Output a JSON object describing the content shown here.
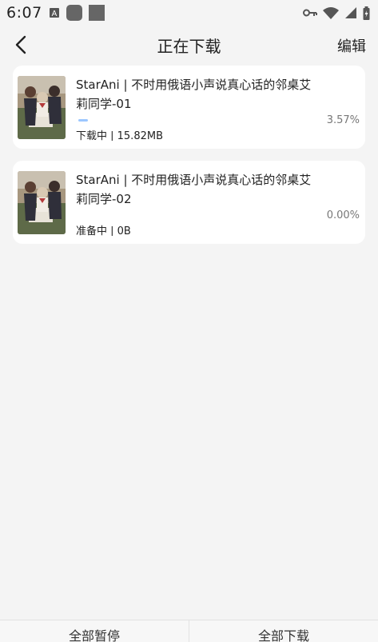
{
  "status_bar": {
    "time": "6:07"
  },
  "header": {
    "title": "正在下载",
    "edit_label": "编辑"
  },
  "downloads": [
    {
      "title": "StarAni | 不时用俄语小声说真心话的邻桌艾莉同学-01",
      "percent": "3.57%",
      "progress": 0.0357,
      "status": "下载中 | 15.82MB"
    },
    {
      "title": "StarAni | 不时用俄语小声说真心话的邻桌艾莉同学-02",
      "percent": "0.00%",
      "progress": 0.0,
      "status": "准备中 | 0B"
    }
  ],
  "bottom": {
    "pause_all": "全部暂停",
    "download_all": "全部下载"
  },
  "colors": {
    "background": "#f4f4f4",
    "card": "#ffffff",
    "progress": "#9cc7ff"
  }
}
